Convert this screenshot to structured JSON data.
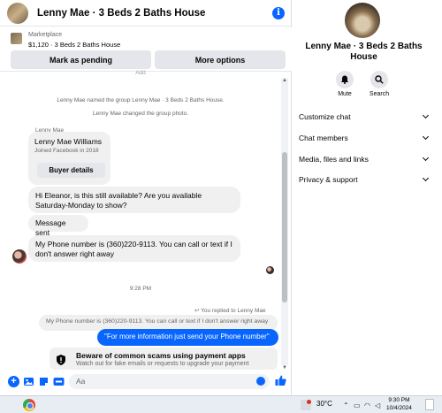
{
  "chat": {
    "title": "Lenny Mae · 3 Beds 2 Baths House",
    "info_icon": "i",
    "marketplace": {
      "label": "Marketplace",
      "listing": "$1,120 · 3 Beds 2 Baths House",
      "mark_pending": "Mark as pending",
      "more_options": "More options"
    },
    "messages": {
      "cut_text": "Add",
      "named_group": "Lenny Mae named the group Lenny Mae · 3 Beds 2 Baths House.",
      "changed_photo": "Lenny Mae changed the group photo.",
      "sender": "Lenny Mae",
      "card_name": "Lenny Mae Williams",
      "card_joined": "Joined Facebook in 2018",
      "buyer_details": "Buyer details",
      "msg1": "Hi Eleanor, is this still available? Are you available Saturday-Monday to show?",
      "msg2": "Message sent",
      "msg3": "My Phone number is (360)220-9113. You can call or text if I don't answer right away",
      "timestamp": "9:28 PM",
      "replied_label": "You replied to Lenny Mae",
      "quoted": "My Phone number is (360)220-9113. You can call or text if I don't answer right away",
      "my_reply": "\"For more information just send your Phone number\"",
      "scam_title": "Beware of common scams using payment apps",
      "scam_sub": "Watch out for fake emails or requests to upgrade your payment"
    },
    "composer": {
      "placeholder": "Aa"
    }
  },
  "info": {
    "group_name": "Lenny Mae · 3 Beds 2 Baths House",
    "mute": "Mute",
    "search": "Search",
    "rows": [
      "Customize chat",
      "Chat members",
      "Media, files and links",
      "Privacy & support"
    ]
  },
  "taskbar": {
    "temperature": "30°C",
    "time": "9:30 PM",
    "date": "10/4/2024"
  },
  "colors": {
    "accent": "#0866ff",
    "bubble_gray": "#f0f0f0",
    "button_gray": "#e4e6eb"
  }
}
